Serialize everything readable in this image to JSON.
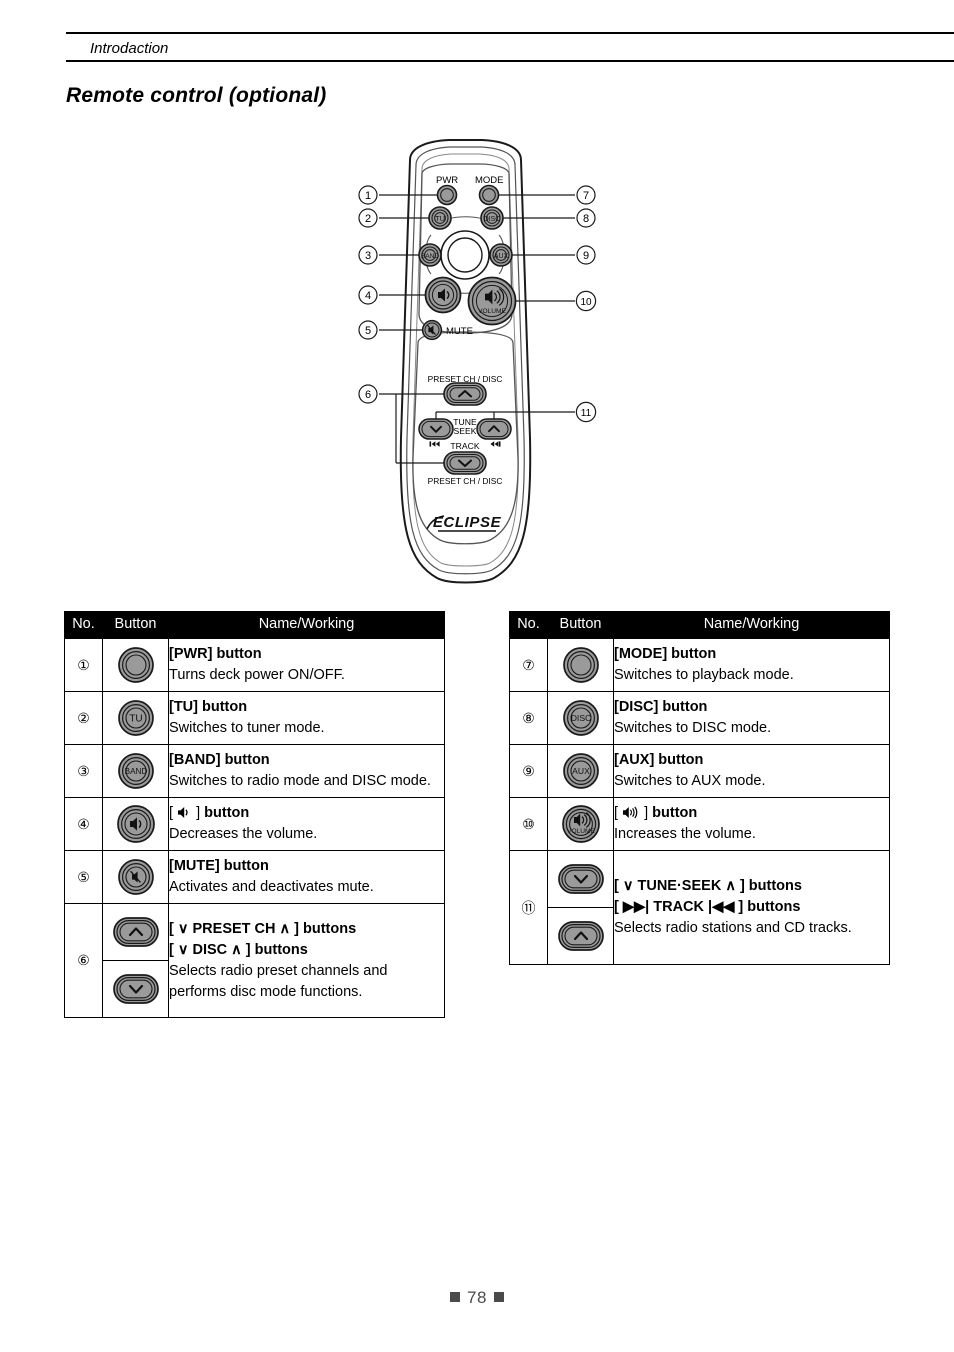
{
  "header": {
    "running_head": "Introdaction"
  },
  "page_title": "Remote control (optional)",
  "figure": {
    "alt_name": "remote-control-diagram",
    "brand": "ECLIPSE",
    "labels": {
      "pwr": "PWR",
      "mode": "MODE",
      "tu": "TU",
      "disc": "DISC",
      "band": "BAND",
      "aux": "AUX",
      "volume": "VOLUME",
      "mute": "MUTE",
      "preset_top": "PRESET CH / DISC",
      "preset_bottom": "PRESET CH / DISC",
      "tune": "TUNE",
      "seek": "SEEK",
      "track": "TRACK"
    },
    "callouts": [
      "1",
      "2",
      "3",
      "4",
      "5",
      "6",
      "7",
      "8",
      "9",
      "10",
      "11"
    ]
  },
  "tables": {
    "headers": [
      "No.",
      "Button",
      "Name/Working"
    ],
    "left_rows": [
      {
        "no": "①",
        "button": "pwr-round-button",
        "title": "[PWR] button",
        "title2": "",
        "desc": "Turns deck power ON/OFF."
      },
      {
        "no": "②",
        "button": "tu-round-button",
        "title": "[TU] button",
        "title2": "",
        "desc": "Switches to tuner mode."
      },
      {
        "no": "③",
        "button": "band-round-button",
        "title": "[BAND] button",
        "title2": "",
        "desc": "Switches to radio mode and DISC mode."
      },
      {
        "no": "④",
        "button": "volume-down-button",
        "title": "[ 🔈 ] button",
        "title2": "",
        "desc": "Decreases the volume."
      },
      {
        "no": "⑤",
        "button": "mute-button",
        "title": "[MUTE] button",
        "title2": "",
        "desc": "Activates and deactivates mute."
      },
      {
        "no": "⑥",
        "button": "preset-up-down-buttons",
        "title": "[ ∨  PRESET CH  ∧ ] buttons",
        "title2": "[ ∨  DISC  ∧ ] buttons",
        "desc": "Selects radio preset channels and performs disc mode functions."
      }
    ],
    "right_rows": [
      {
        "no": "⑦",
        "button": "mode-round-button",
        "title": "[MODE] button",
        "title2": "",
        "desc": "Switches to playback mode."
      },
      {
        "no": "⑧",
        "button": "disc-round-button",
        "title": "[DISC] button",
        "title2": "",
        "desc": "Switches to DISC mode."
      },
      {
        "no": "⑨",
        "button": "aux-round-button",
        "title": "[AUX] button",
        "title2": "",
        "desc": "Switches to AUX mode."
      },
      {
        "no": "⑩",
        "button": "volume-up-button",
        "title": "[ 🔊 ] button",
        "title2": "",
        "desc": "Increases the volume."
      },
      {
        "no": "⑪",
        "button": "tune-seek-track-buttons",
        "title": "[ ∨  TUNE·SEEK  ∧ ] buttons",
        "title2": "[ ▶▶|  TRACK  |◀◀ ] buttons",
        "desc": "Selects radio stations and CD tracks."
      }
    ]
  },
  "footer": {
    "page_number": "78"
  },
  "colors": {
    "button_fill": "#9a9a9a",
    "button_stroke": "#1a1a1a",
    "header_bg": "#000000",
    "footer_gray": "#4a4a4a"
  }
}
